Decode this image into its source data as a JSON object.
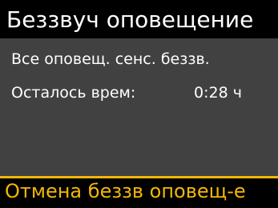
{
  "title": "Беззвуч оповещение",
  "status_text": "Все оповещ. сенс. беззв.",
  "remaining": {
    "label": "Осталось врем:",
    "value": "0:28 ч"
  },
  "action": {
    "label": "Отмена беззв оповещ-е"
  },
  "colors": {
    "title_bg": "#000000",
    "content_bg": "#414141",
    "text": "#ffffff",
    "accent": "#f2b705"
  }
}
